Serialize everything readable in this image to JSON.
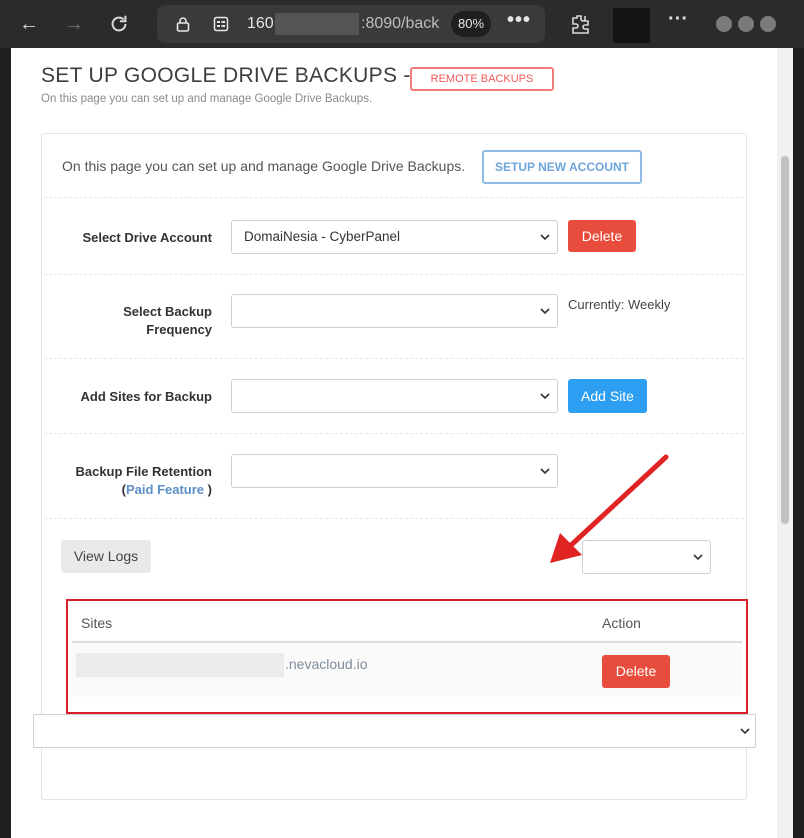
{
  "browser": {
    "url_start": "160.",
    "url_end": ":8090/back",
    "zoom": "80%",
    "more_label": "•••",
    "menu_label": "···"
  },
  "page": {
    "title": "SET UP GOOGLE DRIVE BACKUPS -",
    "badge": "REMOTE BACKUPS",
    "subtitle": "On this page you can set up and manage Google Drive Backups."
  },
  "panel": {
    "intro": "On this page you can set up and manage Google Drive Backups.",
    "setup_button": "SETUP NEW ACCOUNT",
    "account_label": "Select Drive Account",
    "account_value": "DomaiNesia - CyberPanel",
    "delete_button": "Delete",
    "frequency_label_1": "Select Backup",
    "frequency_label_2": "Frequency",
    "frequency_value": "",
    "currently": "Currently: Weekly",
    "add_sites_label": "Add Sites for Backup",
    "add_sites_value": "",
    "add_site_button": "Add Site",
    "retention_label": "Backup File Retention",
    "retention_open": "(",
    "retention_paid": "Paid Feature",
    "retention_close": " )",
    "view_logs": "View Logs"
  },
  "table": {
    "columns": [
      "Sites",
      "Action"
    ],
    "rows": [
      {
        "site": ".nevacloud.io",
        "action": "Delete"
      }
    ]
  },
  "colors": {
    "accent_red": "#e74c3c",
    "accent_blue": "#2e9ef2",
    "highlight_border": "#d61f2a"
  }
}
